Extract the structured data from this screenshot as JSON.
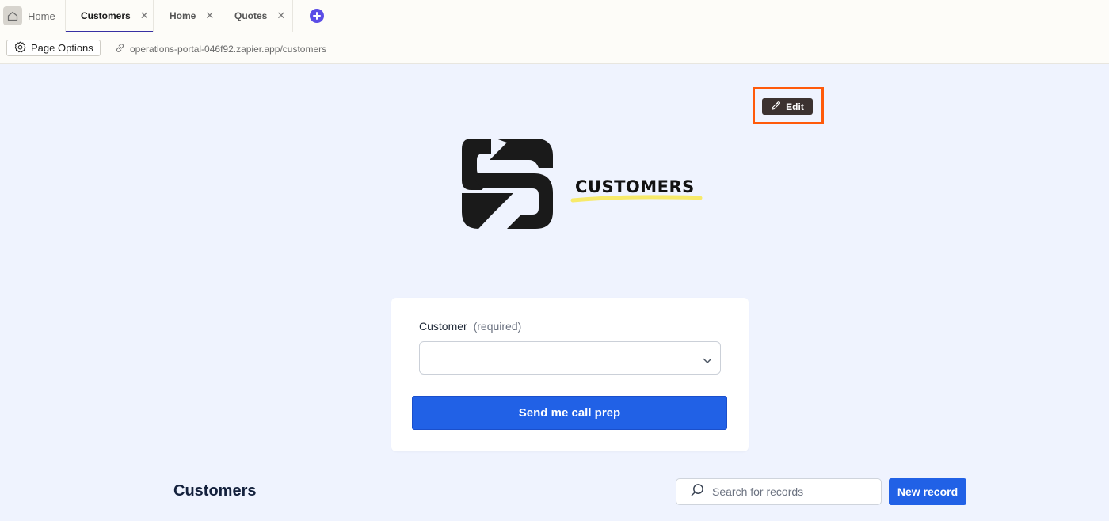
{
  "tabs": {
    "home": {
      "label": "Home",
      "icon": "home-icon"
    },
    "items": [
      {
        "label": "Customers",
        "active": true,
        "close": "✕"
      },
      {
        "label": "Home",
        "active": false,
        "close": "✕"
      },
      {
        "label": "Quotes",
        "active": false,
        "close": "✕"
      }
    ],
    "add_icon": "plus-circle-icon",
    "accent": "#3730a3",
    "add_color": "#5b4de6"
  },
  "toolbar": {
    "page_options_label": "Page Options",
    "page_options_icon": "gear-icon",
    "url_icon": "link-icon",
    "url": "operations-portal-046f92.zapier.app/customers"
  },
  "edit": {
    "label": "Edit",
    "icon": "pencil-icon",
    "highlight_color": "#ff5a0a"
  },
  "header": {
    "logo_title": "CUSTOMERS",
    "underline_color": "#f7ea6a"
  },
  "form": {
    "field_label": "Customer",
    "field_hint": "(required)",
    "select_value": "",
    "submit_label": "Send me call prep",
    "button_color": "#2161e6"
  },
  "records": {
    "title": "Customers",
    "search_placeholder": "Search for records",
    "new_record_label": "New record"
  }
}
